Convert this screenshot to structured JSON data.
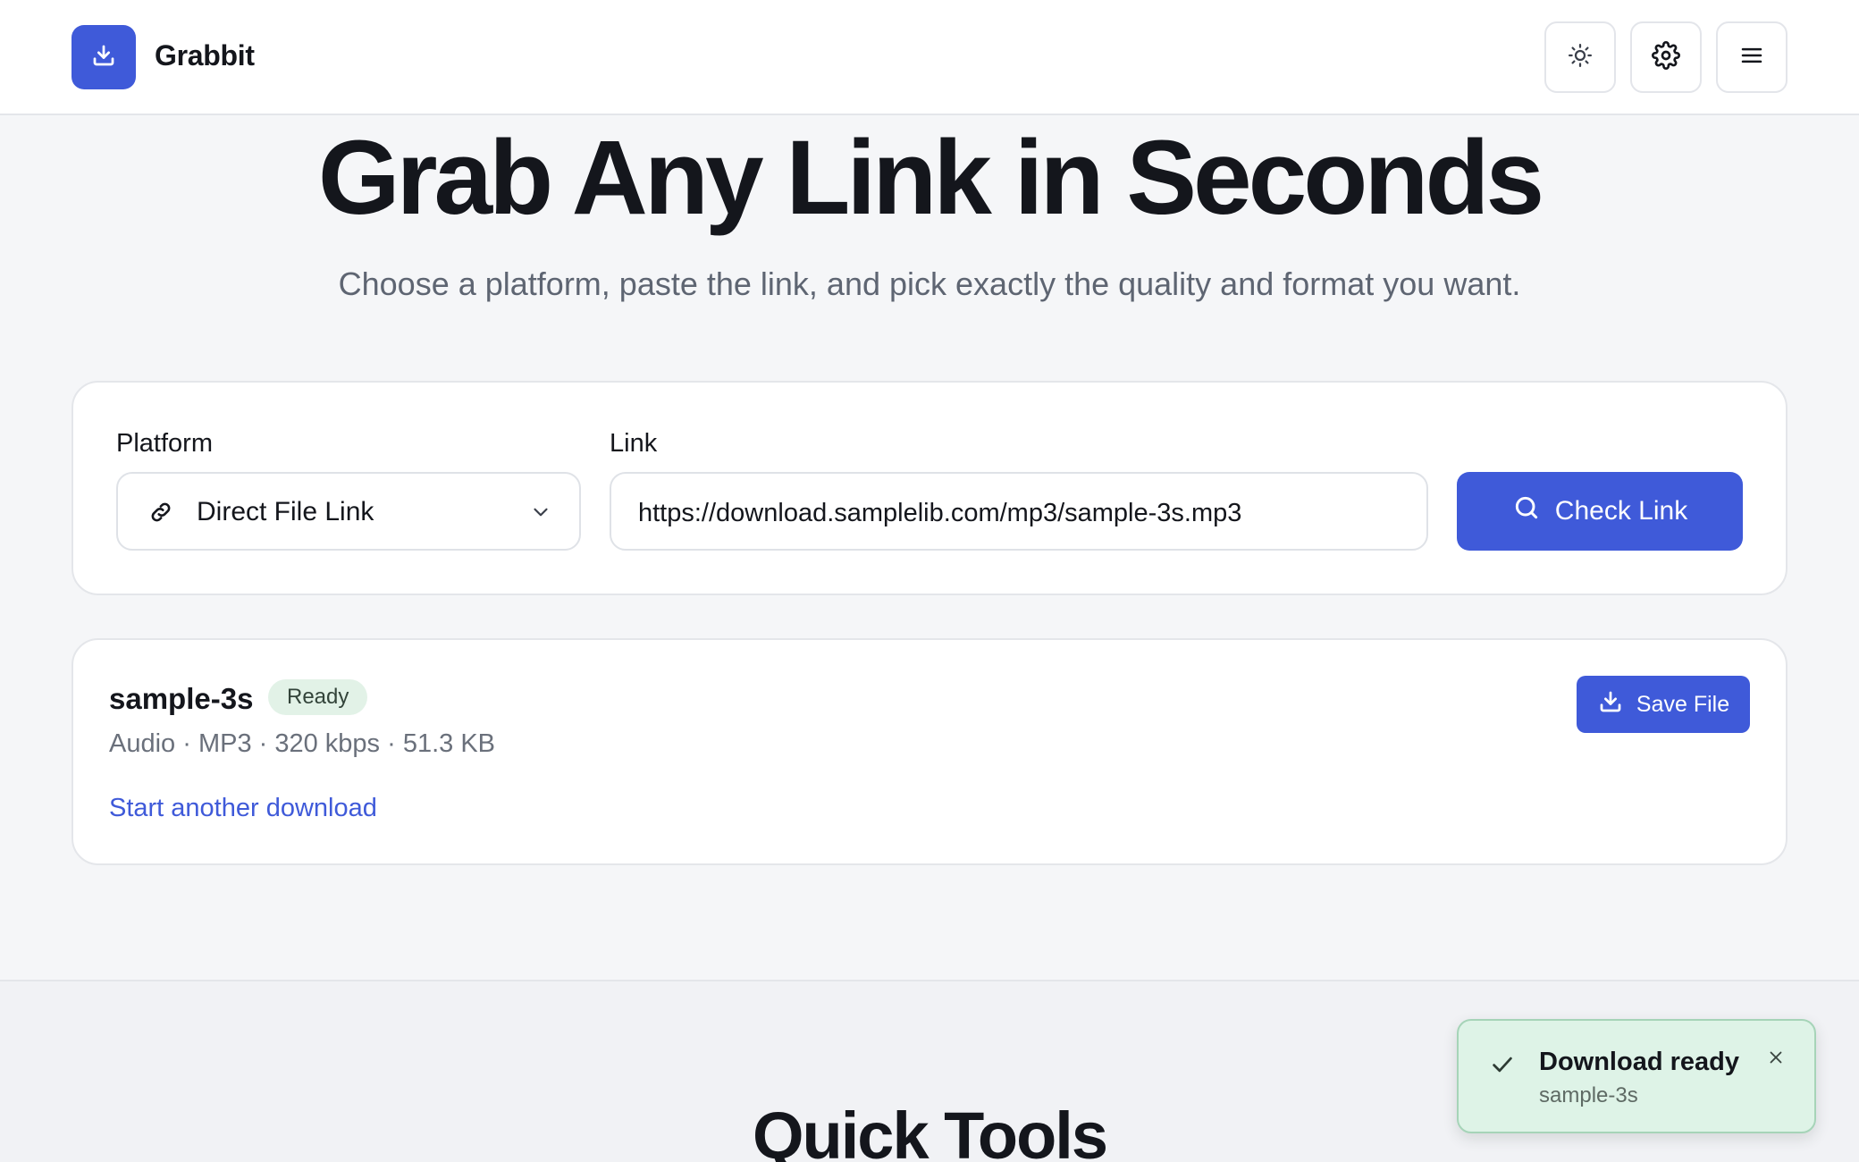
{
  "header": {
    "brand": "Grabbit",
    "icons": [
      "download-icon",
      "sun-icon",
      "gear-icon",
      "menu-icon"
    ]
  },
  "hero": {
    "title": "Grab Any Link in Seconds",
    "subtitle": "Choose a platform, paste the link, and pick exactly the quality and format you want."
  },
  "form": {
    "platform_label": "Platform",
    "platform_value": "Direct File Link",
    "link_label": "Link",
    "link_value": "https://download.samplelib.com/mp3/sample-3s.mp3",
    "check_label": "Check Link"
  },
  "result": {
    "name": "sample-3s",
    "status": "Ready",
    "meta": "Audio · MP3 · 320 kbps · 51.3 KB",
    "save_label": "Save File",
    "another_label": "Start another download"
  },
  "section": {
    "title": "Quick Tools"
  },
  "toast": {
    "title": "Download ready",
    "subtitle": "sample-3s"
  },
  "colors": {
    "accent": "#3f5ad9",
    "success_bg": "#def3e7",
    "success_border": "#a6d4b8",
    "badge_bg": "#e2f2e7"
  }
}
